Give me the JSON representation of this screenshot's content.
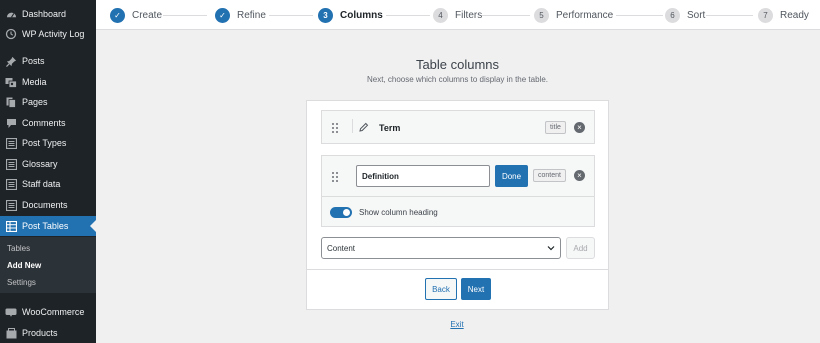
{
  "sidebar": {
    "items": [
      {
        "label": "Dashboard",
        "icon": "dashboard-icon"
      },
      {
        "label": "WP Activity Log",
        "icon": "activity-log-icon"
      },
      {
        "label": "Posts",
        "icon": "pin-icon"
      },
      {
        "label": "Media",
        "icon": "media-icon"
      },
      {
        "label": "Pages",
        "icon": "pages-icon"
      },
      {
        "label": "Comments",
        "icon": "comments-icon"
      },
      {
        "label": "Post Types",
        "icon": "post-types-icon"
      },
      {
        "label": "Glossary",
        "icon": "glossary-icon"
      },
      {
        "label": "Staff data",
        "icon": "staff-data-icon"
      },
      {
        "label": "Documents",
        "icon": "documents-icon"
      },
      {
        "label": "Post Tables",
        "icon": "table-icon"
      },
      {
        "label": "WooCommerce",
        "icon": "woocommerce-icon"
      },
      {
        "label": "Products",
        "icon": "products-icon"
      }
    ],
    "submenu": [
      {
        "label": "Tables"
      },
      {
        "label": "Add New"
      },
      {
        "label": "Settings"
      }
    ]
  },
  "steps": [
    {
      "num": "✓",
      "label": "Create",
      "state": "done"
    },
    {
      "num": "✓",
      "label": "Refine",
      "state": "done"
    },
    {
      "num": "3",
      "label": "Columns",
      "state": "current"
    },
    {
      "num": "4",
      "label": "Filters",
      "state": "todo"
    },
    {
      "num": "5",
      "label": "Performance",
      "state": "todo"
    },
    {
      "num": "6",
      "label": "Sort",
      "state": "todo"
    },
    {
      "num": "7",
      "label": "Ready",
      "state": "todo"
    }
  ],
  "main": {
    "title": "Table columns",
    "subtitle": "Next, choose which columns to display in the table.",
    "columns": [
      {
        "label": "Term",
        "tag": "title"
      },
      {
        "label": "Definition",
        "tag": "content",
        "done_label": "Done",
        "toggle_label": "Show column heading",
        "toggle_on": true
      }
    ],
    "select_value": "Content",
    "add_label": "Add",
    "back_label": "Back",
    "next_label": "Next",
    "exit_label": "Exit"
  },
  "colors": {
    "accent": "#2271b1",
    "sidebar_bg": "#1d2327",
    "background": "#f0f0f1"
  }
}
